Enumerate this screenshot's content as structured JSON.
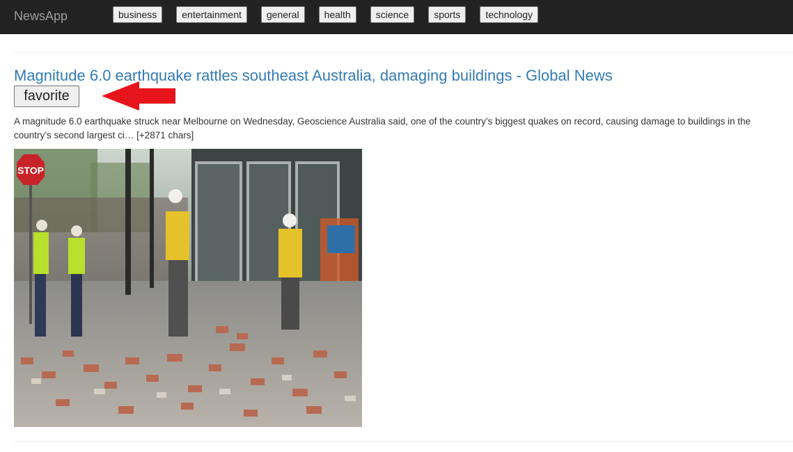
{
  "navbar": {
    "brand": "NewsApp",
    "categories": [
      "business",
      "entertainment",
      "general",
      "health",
      "science",
      "sports",
      "technology"
    ]
  },
  "article": {
    "title": "Magnitude 6.0 earthquake rattles southeast Australia, damaging buildings - Global News",
    "favorite_label": "favorite",
    "description": "A magnitude 6.0 earthquake struck near Melbourne on Wednesday, Geoscience Australia said, one of the country’s biggest quakes on record, causing damage to buildings in the country’s second largest ci… [+2871 chars]",
    "image_sign_text": "STOP"
  },
  "colors": {
    "navbar_bg": "#222222",
    "link": "#337ab7",
    "arrow": "#e8141c"
  }
}
